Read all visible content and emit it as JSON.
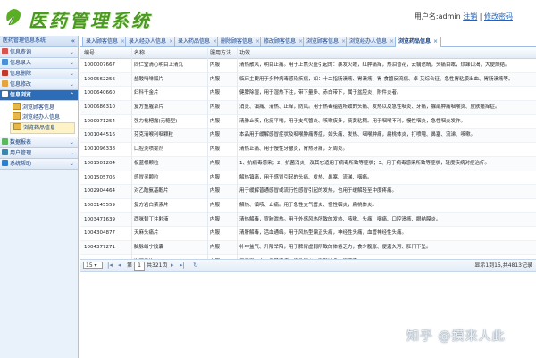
{
  "app": {
    "title": "医药管理系统",
    "user_label": "用户名:admin",
    "logout": "注销",
    "change_password": "修改密码"
  },
  "sidebar": {
    "title": "医药管理信息系统",
    "collapse": "«",
    "menus": [
      {
        "label": "信息查询",
        "icon_color": "#d9534f"
      },
      {
        "label": "信息录入",
        "icon_color": "#4a90d9"
      },
      {
        "label": "信息删除",
        "icon_color": "#c0392b"
      },
      {
        "label": "信息修改",
        "icon_color": "#e6a23c"
      },
      {
        "label": "信息浏览",
        "icon_color": "#ffffff",
        "active": true
      },
      {
        "label": "数据报表",
        "icon_color": "#5cb85c"
      },
      {
        "label": "用户管理",
        "icon_color": "#3a87ad"
      },
      {
        "label": "系统帮助",
        "icon_color": "#2c7fd0"
      }
    ],
    "submenu": [
      {
        "label": "浏览顾客信息"
      },
      {
        "label": "浏览经办人信息"
      },
      {
        "label": "浏览药品信息",
        "selected": true
      }
    ]
  },
  "tabs": [
    {
      "label": "录入顾客信息"
    },
    {
      "label": "录入经办人信息"
    },
    {
      "label": "录入药品信息"
    },
    {
      "label": "删除顾客信息"
    },
    {
      "label": "修改顾客信息"
    },
    {
      "label": "浏览顾客信息"
    },
    {
      "label": "浏览经办人信息"
    },
    {
      "label": "浏览药品信息",
      "active": true
    }
  ],
  "table": {
    "columns": [
      "编号",
      "名称",
      "服用方法",
      "功效"
    ],
    "rows": [
      [
        "1000007667",
        "同仁堂清心明目上清丸",
        "内服",
        "清热散风，明目止痛。用于上焦火盛引起的：暴发火眼，红肿痛痒，热泪昏花，云翳遮睛，头痛目眩，烦躁口渴，大便燥结。"
      ],
      [
        "1000562256",
        "盐酸吗啉胍片",
        "内服",
        "临床主要用于多种病毒感染疾病，如：十二指肠溃疡、胃溃疡、胃-食管反流病、卓-艾综合征、急性胃粘膜出血、胃肠溃疡等。"
      ],
      [
        "1000640660",
        "妇科千金片",
        "内服",
        "健脾除湿，用于湿热下注，带下量多、赤白带下，属于盆腔炎、附件炎者。"
      ],
      [
        "1000686310",
        "复方鱼腥草片",
        "内服",
        "消炎、镇痛、清热、止痒，防风。用于热毒蕴结所致的头痛、发热以及急性咽炎、牙痛，腺部肿痛咽喉炎、皮肤瘙痒症。"
      ],
      [
        "1000971254",
        "强力枇杷露(无糖型)",
        "内服",
        "清肺止咳，化痰平喘，用于支气管炎、咳嗽痰多，痰黄粘稠。用于咽喉不利，慢性咽炎，急性咽炎发作。"
      ],
      [
        "1001044516",
        "芬克清喉利咽颗粒",
        "内服",
        "本品用于缓解感冒症状及咽喉肿痛等症，如头痛、发热、咽喉肿痛，扁桃体炎，打喷嚏、鼻塞、流涕、咳嗽。"
      ],
      [
        "1001096338",
        "口腔炎喷雾剂",
        "内服",
        "清热止痛、用于慢性牙龈炎，胃热牙痛，牙周炎。"
      ],
      [
        "1001501204",
        "板蓝根颗粒",
        "内服",
        "1、抗病毒感染；2、抗菌消炎，及其它适用于病毒所致等症状；3、用于病毒感染所致等症状，轻度疾病对症治疗。"
      ],
      [
        "1001505706",
        "感冒灵颗粒",
        "内服",
        "解热镇痛，用于感冒引起的头痛、发热、鼻塞、流涕、咽痛。"
      ],
      [
        "1002904464",
        "对乙酰氨基酚片",
        "内服",
        "用于缓解普通感冒或流行性感冒引起的发热，也用于缓解轻至中度疼痛。"
      ],
      [
        "1003145559",
        "复方岩白菜素片",
        "内服",
        "解热、镇咳、止痛。用于急性支气管炎、慢性咽炎，扁桃体炎。"
      ],
      [
        "1003471639",
        "西咪替丁注射液",
        "内服",
        "清热解毒，宣肺泄热。用于外感风热所致的发热、咳嗽、头痛、咽痛、口腔溃疡、眼结膜炎。"
      ],
      [
        "1004304877",
        "天麻头痛片",
        "内服",
        "清肝解毒，活血通络。用于风热型偏正头痛，神经性头痛，血管神经性头痛。"
      ],
      [
        "1004377271",
        "脑脉络宁胶囊",
        "内服",
        "补中益气、升阳举陷，用于脾胃虚弱所致的体倦乏力，食少腹胀、便溏久泻、肛门下坠。"
      ],
      [
        "1004409969",
        "次可予片",
        "内服",
        "用于胃、十二指肠溃疡，慢性胃炎，胃酸过多，胃痉挛。"
      ]
    ]
  },
  "pager": {
    "page_size": "15",
    "page_prefix": "第",
    "page_value": "1",
    "page_total": "共321页",
    "info": "显示1到15,共4813记录"
  },
  "watermark": "知乎 @摸来人此"
}
